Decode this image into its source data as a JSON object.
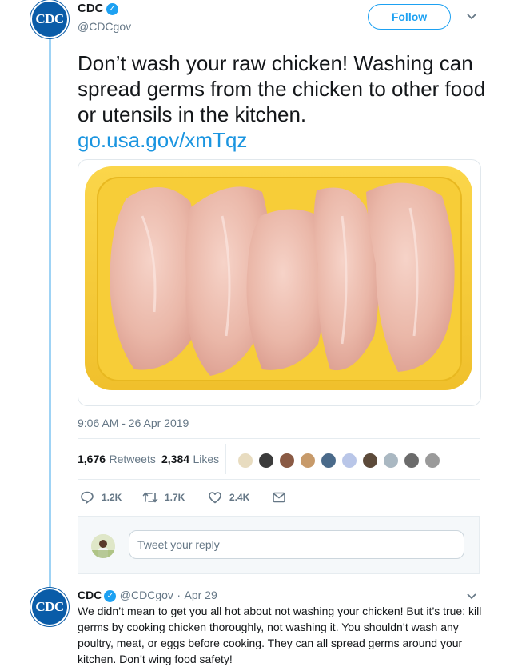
{
  "tweet": {
    "author_name": "CDC",
    "author_handle": "@CDCgov",
    "avatar_text": "CDC",
    "follow_label": "Follow",
    "text": "Don’t wash your raw chicken! Washing can spread germs from the chicken to other food or utensils in the kitchen.",
    "link": "go.usa.gov/xmTqz",
    "timestamp": "9:06 AM - 26 Apr 2019",
    "retweets_count": "1,676",
    "retweets_label": "Retweets",
    "likes_count": "2,384",
    "likes_label": "Likes",
    "actions": {
      "replies": "1.2K",
      "retweets": "1.7K",
      "likes": "2.4K"
    }
  },
  "reply_box": {
    "placeholder": "Tweet your reply"
  },
  "reply": {
    "author_name": "CDC",
    "author_handle": "@CDCgov",
    "separator": "·",
    "date": "Apr 29",
    "avatar_text": "CDC",
    "text": "We didn’t mean to get you all hot about not washing your chicken! But it’s true: kill germs by cooking chicken thoroughly, not washing it. You shouldn’t wash any poultry, meat, or eggs before cooking. They can all spread germs around your kitchen. Don’t wing food safety!"
  },
  "colors": {
    "accent": "#1da1f2",
    "link": "#1b95e0",
    "cdc_blue": "#0a5ca8",
    "thread_line": "#9fd3f5"
  },
  "icons": [
    "verified-icon",
    "chevron-down-icon",
    "reply-icon",
    "retweet-icon",
    "like-icon",
    "message-icon"
  ]
}
